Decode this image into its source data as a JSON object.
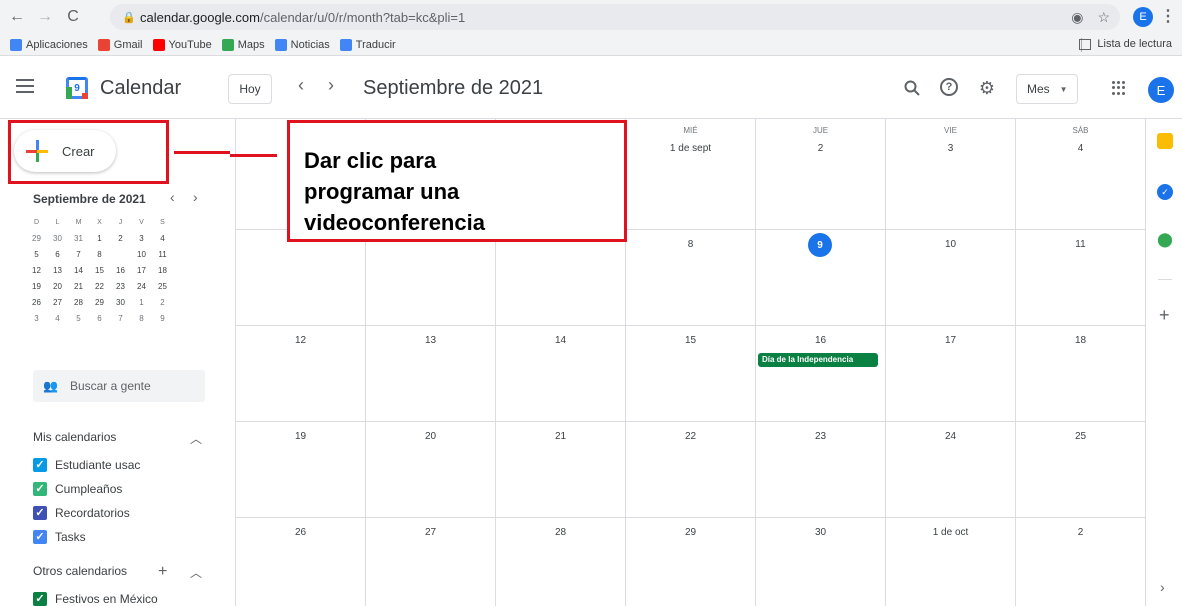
{
  "browser": {
    "url_host": "calendar.google.com",
    "url_path": "/calendar/u/0/r/month?tab=kc&pli=1",
    "profile_initial": "E",
    "bookmarks": [
      {
        "label": "Aplicaciones",
        "color": "#4285f4"
      },
      {
        "label": "Gmail",
        "color": "#ea4335"
      },
      {
        "label": "YouTube",
        "color": "#ff0000"
      },
      {
        "label": "Maps",
        "color": "#34a853"
      },
      {
        "label": "Noticias",
        "color": "#4285f4"
      },
      {
        "label": "Traducir",
        "color": "#4285f4"
      }
    ],
    "reading_list": "Lista de lectura"
  },
  "header": {
    "app_title": "Calendar",
    "logo_day": "9",
    "today_label": "Hoy",
    "month_title": "Septiembre de 2021",
    "view_label": "Mes",
    "avatar_initial": "E"
  },
  "sidebar": {
    "create_label": "Crear",
    "mini_title": "Septiembre de 2021",
    "mini_dow": [
      "D",
      "L",
      "M",
      "X",
      "J",
      "V",
      "S"
    ],
    "mini_weeks": [
      [
        "29",
        "30",
        "31",
        "1",
        "2",
        "3",
        "4"
      ],
      [
        "5",
        "6",
        "7",
        "8",
        "9",
        "10",
        "11"
      ],
      [
        "12",
        "13",
        "14",
        "15",
        "16",
        "17",
        "18"
      ],
      [
        "19",
        "20",
        "21",
        "22",
        "23",
        "24",
        "25"
      ],
      [
        "26",
        "27",
        "28",
        "29",
        "30",
        "1",
        "2"
      ],
      [
        "3",
        "4",
        "5",
        "6",
        "7",
        "8",
        "9"
      ]
    ],
    "search_people": "Buscar a gente",
    "my_calendars_title": "Mis calendarios",
    "my_calendars": [
      {
        "label": "Estudiante usac",
        "color": "#039be5"
      },
      {
        "label": "Cumpleaños",
        "color": "#33b679"
      },
      {
        "label": "Recordatorios",
        "color": "#3f51b5"
      },
      {
        "label": "Tasks",
        "color": "#4285f4"
      }
    ],
    "other_calendars_title": "Otros calendarios",
    "other_calendars": [
      {
        "label": "Festivos en México",
        "color": "#0b8043"
      }
    ]
  },
  "month": {
    "weekday_labels": [
      "",
      "",
      "",
      "MIÉ",
      "JUE",
      "VIE",
      "SÁB"
    ],
    "weeks": [
      [
        "",
        "",
        "",
        "1 de sept",
        "2",
        "3",
        "4"
      ],
      [
        "",
        "",
        "",
        "8",
        "9",
        "10",
        "11"
      ],
      [
        "12",
        "13",
        "14",
        "15",
        "16",
        "17",
        "18"
      ],
      [
        "19",
        "20",
        "21",
        "22",
        "23",
        "24",
        "25"
      ],
      [
        "26",
        "27",
        "28",
        "29",
        "30",
        "1 de oct",
        "2"
      ]
    ],
    "event": "Día de la Independencia",
    "event_color": "#0b8043"
  },
  "annotation": {
    "text_line1": "Dar clic para",
    "text_line2": "programar una",
    "text_line3": "videoconferencia",
    "color": "#e0121e"
  }
}
